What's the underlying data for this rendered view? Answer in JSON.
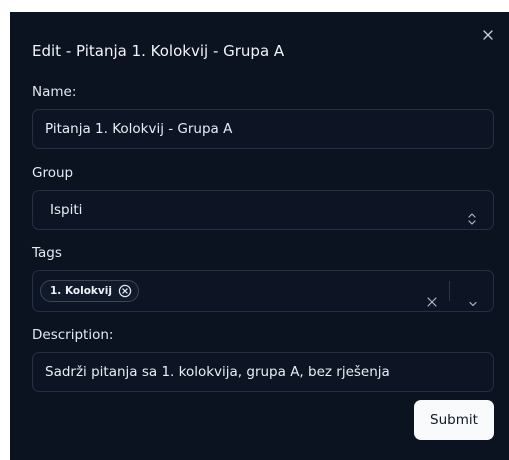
{
  "dialog": {
    "title": "Edit - Pitanja 1. Kolokvij - Grupa A",
    "close_icon": "close-icon"
  },
  "name_field": {
    "label": "Name:",
    "value": "Pitanja 1. Kolokvij - Grupa A"
  },
  "group_field": {
    "label": "Group",
    "value": "Ispiti",
    "icon": "chevron-up-down-icon"
  },
  "tags_field": {
    "label": "Tags",
    "tags": [
      "1. Kolokvij"
    ],
    "clear_icon": "clear-icon",
    "dropdown_icon": "chevron-down-icon"
  },
  "description_field": {
    "label": "Description:",
    "value": "Sadrži pitanja sa 1. kolokvija, grupa A, bez rješenja"
  },
  "actions": {
    "submit_label": "Submit"
  },
  "colors": {
    "background": "#0b1220",
    "field_border": "#253044",
    "button_bg": "#f8fafc"
  }
}
